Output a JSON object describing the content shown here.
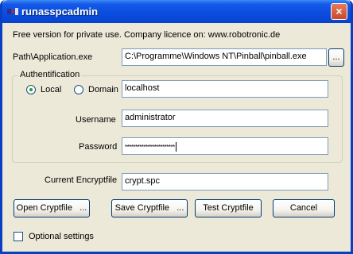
{
  "window": {
    "title": "runasspcadmin",
    "close_glyph": "×"
  },
  "info_text": "Free version for private use. Company licence on: www.robotronic.de",
  "app_path": {
    "label": "Path\\Application.exe",
    "value": "C:\\Programme\\Windows NT\\Pinball\\pinball.exe",
    "browse_label": "..."
  },
  "auth": {
    "group_label": "Authentification",
    "local_label": "Local",
    "domain_label": "Domain",
    "selected": "local",
    "host_value": "localhost",
    "username_label": "Username",
    "username_value": "administrator",
    "password_label": "Password",
    "password_mask": "************************"
  },
  "cryptfile": {
    "label": "Current Encryptfile",
    "value": "crypt.spc"
  },
  "buttons": {
    "open": "Open Cryptfile",
    "open_more": "...",
    "save": "Save Cryptfile",
    "save_more": "...",
    "test": "Test Cryptfile",
    "cancel": "Cancel"
  },
  "optional": {
    "label": "Optional settings",
    "checked": false
  },
  "icons": {
    "app": "runas-app-icon",
    "close": "close-icon"
  }
}
